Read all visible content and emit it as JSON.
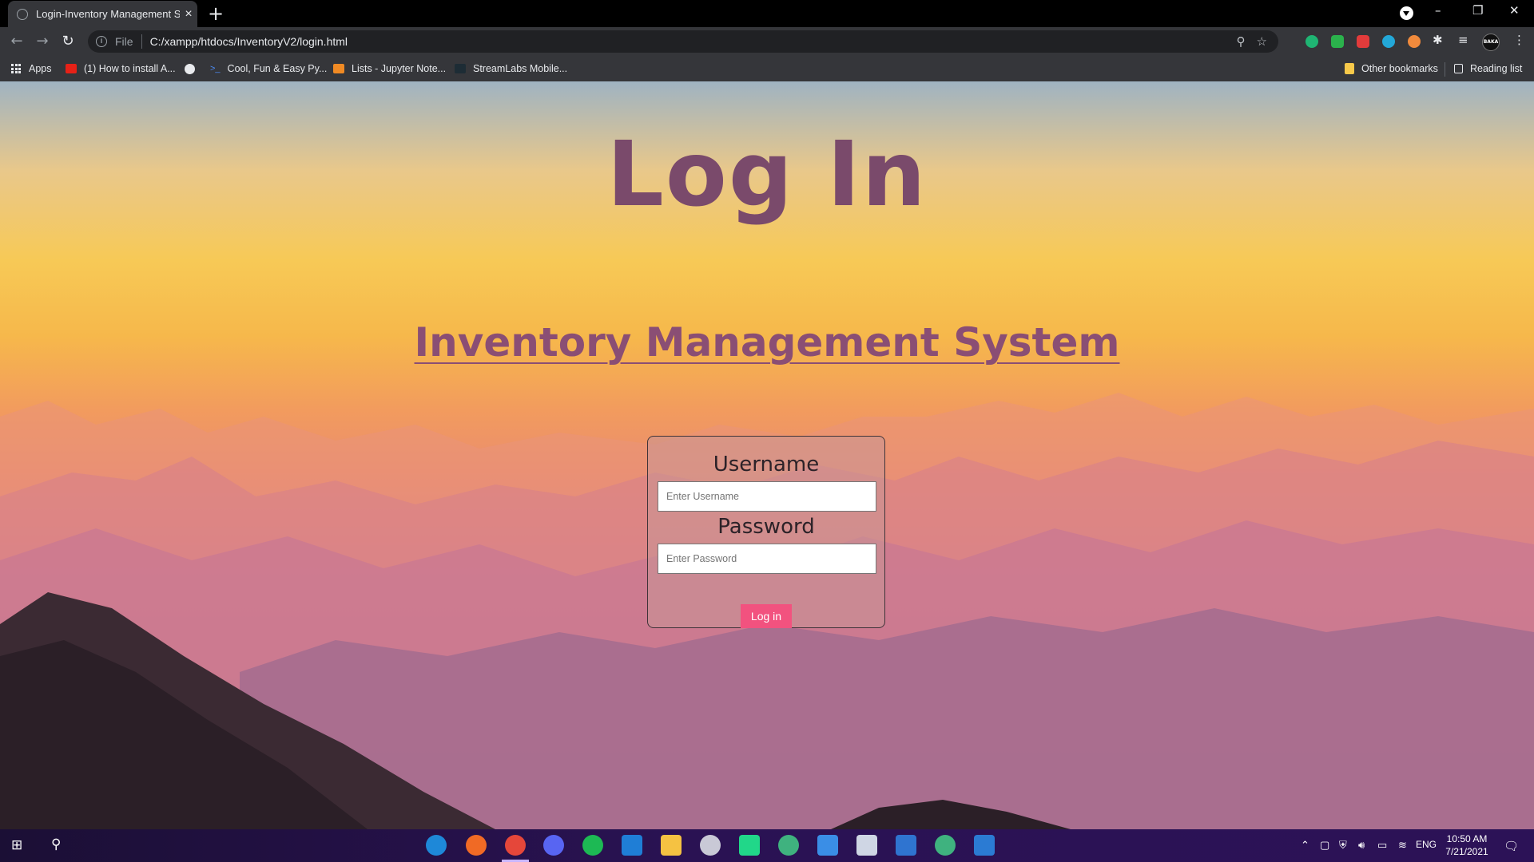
{
  "browser": {
    "tab_title": "Login-Inventory Management Sy",
    "new_tab": "+",
    "minimize": "–",
    "restore": "❐",
    "close": "✕",
    "url_scheme": "File",
    "url": "C:/xampp/htdocs/InventoryV2/login.html",
    "avatar_text": "BAKA"
  },
  "bookmarks": [
    {
      "label": "Apps",
      "icon": "apps-grid-icon"
    },
    {
      "label": "(1) How to install A...",
      "icon": "youtube-icon"
    },
    {
      "label": "",
      "icon": "github-icon"
    },
    {
      "label": "Cool, Fun & Easy Py...",
      "icon": "terminal-icon"
    },
    {
      "label": "Lists - Jupyter Note...",
      "icon": "book-icon"
    },
    {
      "label": "StreamLabs Mobile...",
      "icon": "streamlabs-icon"
    }
  ],
  "bookmarks_right": {
    "other": "Other bookmarks",
    "reading": "Reading list"
  },
  "page": {
    "title": "Log In",
    "subtitle": "Inventory Management System",
    "username_label": "Username",
    "username_placeholder": "Enter Username",
    "password_label": "Password",
    "password_placeholder": "Enter Password",
    "login_button": "Log in"
  },
  "taskbar": {
    "language": "ENG",
    "time": "10:50 AM",
    "date": "7/21/2021"
  },
  "colors": {
    "title": "#7a4a6b",
    "subtitle": "#8a4e74",
    "login_button": "#f2527f",
    "taskbar": "#2a1253"
  }
}
